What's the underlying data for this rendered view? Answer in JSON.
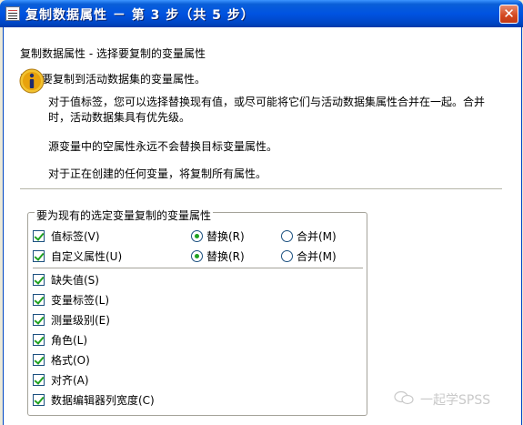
{
  "window": {
    "title": "复制数据属性 － 第 3 步（共 5 步）",
    "close_symbol": "✕"
  },
  "header": {
    "heading": "复制数据属性 - 选择要复制的变量属性",
    "intro": "选择要复制到活动数据集的变量属性。"
  },
  "info": {
    "icon": "info-icon",
    "line1": "对于值标签，您可以选择替换现有值，或尽可能将它们与活动数据集属性合并在一起。合并",
    "line2": "时，活动数据集具有优先级。",
    "missing_note": "源变量中的空属性永远不会替换目标变量属性。",
    "new_vars_note": "对于正在创建的任何变量，将复制所有属性。"
  },
  "group": {
    "legend": "要为现有的选定变量复制的变量属性",
    "rows_with_options": [
      {
        "label": "值标签(V)",
        "checked": true,
        "replace_label": "替换(R)",
        "merge_label": "合并(M)",
        "selected": "replace"
      },
      {
        "label": "自定义属性(U)",
        "checked": true,
        "replace_label": "替换(R)",
        "merge_label": "合并(M)",
        "selected": "replace"
      }
    ],
    "checkboxes": [
      {
        "label": "缺失值(S)",
        "checked": true
      },
      {
        "label": "变量标签(L)",
        "checked": true
      },
      {
        "label": "测量级别(E)",
        "checked": true
      },
      {
        "label": "角色(L)",
        "checked": true
      },
      {
        "label": "格式(O)",
        "checked": true
      },
      {
        "label": "对齐(A)",
        "checked": true
      },
      {
        "label": "数据编辑器列宽度(C)",
        "checked": true
      }
    ]
  },
  "watermark": {
    "text": "一起学SPSS",
    "icon": "wechat-icon"
  },
  "colors": {
    "titlebar": "#0053e1",
    "checkmark": "#21a121",
    "window_bg": "#ffffff"
  }
}
